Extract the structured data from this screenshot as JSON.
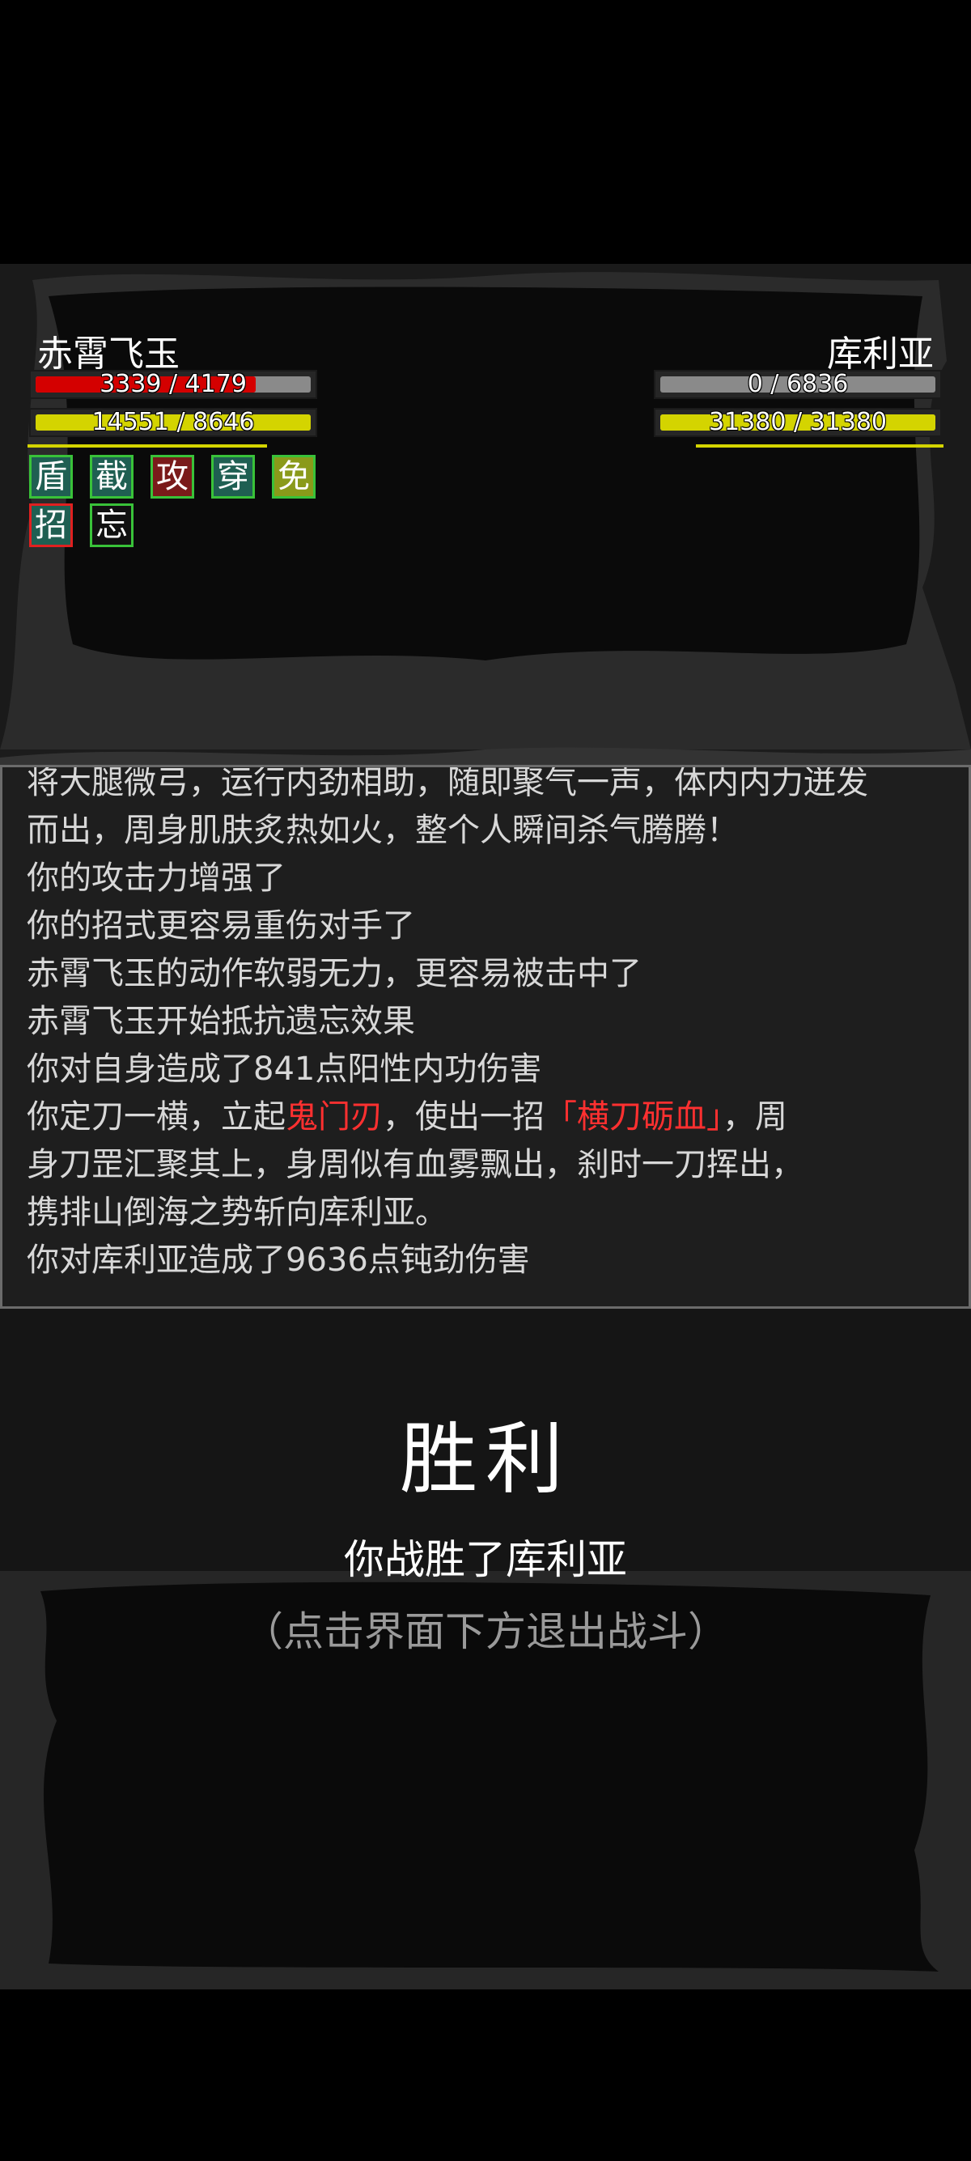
{
  "player": {
    "name": "赤霄飞玉",
    "hp_text": "3339 / 4179",
    "hp_fraction": 0.799,
    "mp_text": "14551 / 8646",
    "mp_fraction": 1.0,
    "buffs": [
      {
        "label": "盾",
        "bg": "#1f5f52",
        "border": "#39c239"
      },
      {
        "label": "截",
        "bg": "#1f5f52",
        "border": "#39c239"
      },
      {
        "label": "攻",
        "bg": "#7a1a1a",
        "border": "#39c239"
      },
      {
        "label": "穿",
        "bg": "#1f5f52",
        "border": "#39c239"
      },
      {
        "label": "免",
        "bg": "#8a9a1a",
        "border": "#39c239"
      },
      {
        "label": "招",
        "bg": "#1f5f52",
        "border": "#e02020"
      },
      {
        "label": "忘",
        "bg": "#111111",
        "border": "#39c239"
      }
    ]
  },
  "enemy": {
    "name": "库利亚",
    "hp_text": "0 / 6836",
    "hp_fraction": 0.0,
    "mp_text": "31380 / 31380",
    "mp_fraction": 1.0
  },
  "colors": {
    "hp": "#d40000",
    "mp": "#d4d400",
    "player_figure": "#f5f000",
    "weapon": "#e8201a",
    "highlight": "#ff3030"
  },
  "log": {
    "lines": [
      {
        "parts": [
          {
            "t": "将大腿微弓，运行内劲相助，随即聚气一声，体内内力迸发"
          }
        ]
      },
      {
        "parts": [
          {
            "t": "而出，周身肌肤炙热如火，整个人瞬间杀气腾腾！"
          }
        ]
      },
      {
        "parts": [
          {
            "t": "你的攻击力增强了"
          }
        ]
      },
      {
        "parts": [
          {
            "t": "你的招式更容易重伤对手了"
          }
        ]
      },
      {
        "parts": [
          {
            "t": "赤霄飞玉的动作软弱无力，更容易被击中了"
          }
        ]
      },
      {
        "parts": [
          {
            "t": "赤霄飞玉开始抵抗遗忘效果"
          }
        ]
      },
      {
        "parts": [
          {
            "t": "你对自身造成了841点阳性内功伤害"
          }
        ]
      },
      {
        "parts": [
          {
            "t": "你定刀一横，立起"
          },
          {
            "t": "鬼门刃",
            "hl": true
          },
          {
            "t": "，使出一招"
          },
          {
            "t": "「横刀砺血」",
            "hl": true
          },
          {
            "t": "，周"
          }
        ]
      },
      {
        "parts": [
          {
            "t": "身刀罡汇聚其上，身周似有血雾飘出，刹时一刀挥出，"
          }
        ]
      },
      {
        "parts": [
          {
            "t": "携排山倒海之势斩向库利亚。"
          }
        ]
      },
      {
        "parts": [
          {
            "t": "你对库利亚造成了9636点钝劲伤害"
          }
        ]
      }
    ]
  },
  "result": {
    "title": "胜利",
    "subtitle": "你战胜了库利亚",
    "hint": "（点击界面下方退出战斗）"
  }
}
